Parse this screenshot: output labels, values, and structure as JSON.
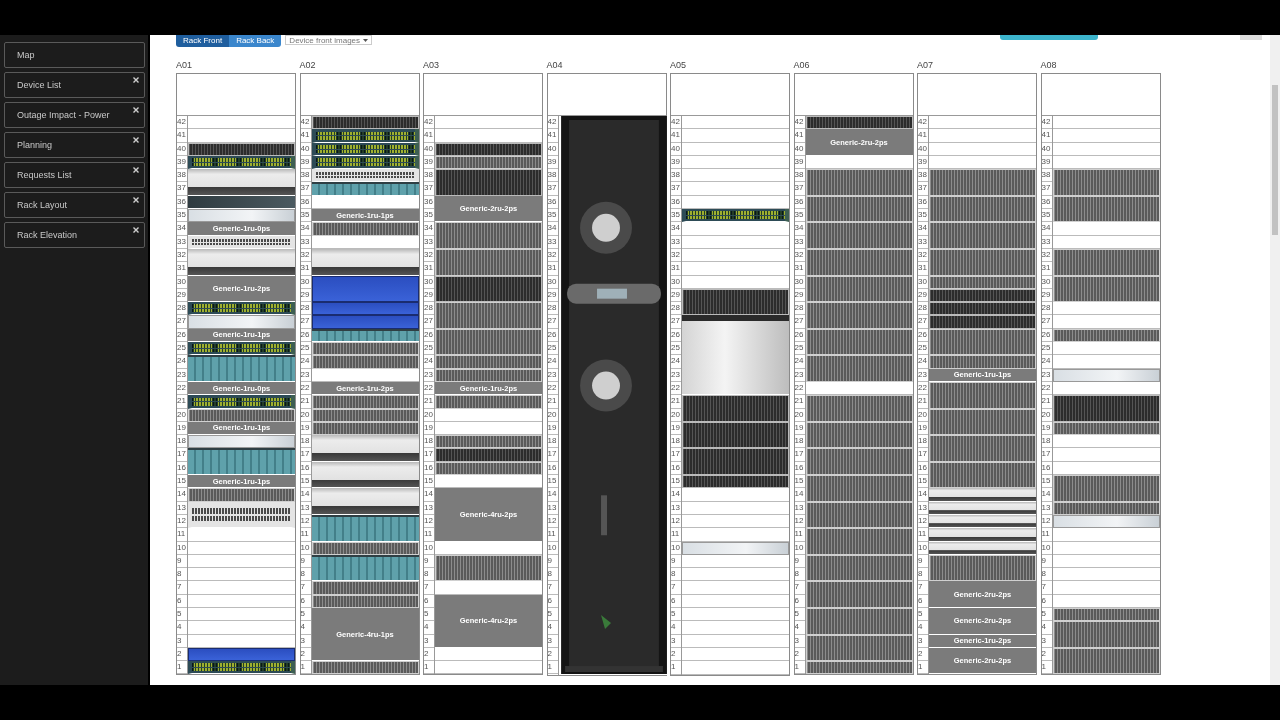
{
  "sidebar": {
    "items": [
      {
        "label": "Map",
        "closable": false
      },
      {
        "label": "Device List",
        "closable": true
      },
      {
        "label": "Outage Impact - Power",
        "closable": true
      },
      {
        "label": "Planning",
        "closable": true
      },
      {
        "label": "Requests List",
        "closable": true
      },
      {
        "label": "Rack Layout",
        "closable": true
      },
      {
        "label": "Rack Elevation",
        "closable": true
      }
    ]
  },
  "toolbar": {
    "tabs": [
      {
        "label": "Rack Front",
        "selected": true
      },
      {
        "label": "Rack Back",
        "selected": false
      }
    ],
    "dropdown": {
      "value": "Device front images"
    }
  },
  "racks": [
    {
      "name": "A01",
      "slots": [
        {
          "kind": "empty",
          "units": [
            "42",
            "41"
          ]
        },
        {
          "kind": "blade_dark",
          "units": [
            "40"
          ]
        },
        {
          "kind": "switch",
          "units": [
            "39"
          ]
        },
        {
          "kind": "server",
          "units": [
            "38",
            "37"
          ]
        },
        {
          "kind": "appliance_dark",
          "units": [
            "36"
          ]
        },
        {
          "kind": "appliance",
          "units": [
            "35"
          ]
        },
        {
          "kind": "generic",
          "units": [
            "34"
          ],
          "label": "Generic-1ru-0ps"
        },
        {
          "kind": "switch_light",
          "units": [
            "33"
          ]
        },
        {
          "kind": "server",
          "units": [
            "32",
            "31"
          ]
        },
        {
          "kind": "generic",
          "units": [
            "30",
            "29"
          ],
          "label": "Generic-1ru-2ps"
        },
        {
          "kind": "switch",
          "units": [
            "28"
          ]
        },
        {
          "kind": "appliance",
          "units": [
            "27"
          ]
        },
        {
          "kind": "generic",
          "units": [
            "26"
          ],
          "label": "Generic-1ru-1ps"
        },
        {
          "kind": "switch",
          "units": [
            "25"
          ]
        },
        {
          "kind": "chassis",
          "units": [
            "24",
            "23"
          ]
        },
        {
          "kind": "generic",
          "units": [
            "22"
          ],
          "label": "Generic-1ru-0ps"
        },
        {
          "kind": "switch",
          "units": [
            "21"
          ]
        },
        {
          "kind": "blade",
          "units": [
            "20"
          ]
        },
        {
          "kind": "generic",
          "units": [
            "19"
          ],
          "label": "Generic-1ru-1ps"
        },
        {
          "kind": "appliance",
          "units": [
            "18"
          ]
        },
        {
          "kind": "chassis",
          "units": [
            "17",
            "16"
          ]
        },
        {
          "kind": "generic",
          "units": [
            "15"
          ],
          "label": "Generic-1ru-1ps"
        },
        {
          "kind": "blade",
          "units": [
            "14"
          ]
        },
        {
          "kind": "switch_light",
          "units": [
            "13",
            "12"
          ]
        },
        {
          "kind": "empty",
          "units": [
            "11",
            "10",
            "9",
            "8",
            "7",
            "6",
            "5",
            "4",
            "3"
          ]
        },
        {
          "kind": "blue",
          "units": [
            "2"
          ]
        },
        {
          "kind": "switch",
          "units": [
            "1"
          ]
        }
      ]
    },
    {
      "name": "A02",
      "slots": [
        {
          "kind": "blade_dark",
          "units": [
            "42"
          ]
        },
        {
          "kind": "switch",
          "units": [
            "41"
          ]
        },
        {
          "kind": "switch",
          "units": [
            "40"
          ]
        },
        {
          "kind": "switch",
          "units": [
            "39"
          ]
        },
        {
          "kind": "switch_light",
          "units": [
            "38"
          ]
        },
        {
          "kind": "chassis",
          "units": [
            "37"
          ]
        },
        {
          "kind": "empty",
          "units": [
            "36"
          ]
        },
        {
          "kind": "generic",
          "units": [
            "35"
          ],
          "label": "Generic-1ru-1ps"
        },
        {
          "kind": "blade",
          "units": [
            "34"
          ]
        },
        {
          "kind": "empty",
          "units": [
            "33"
          ]
        },
        {
          "kind": "server",
          "units": [
            "32",
            "31"
          ]
        },
        {
          "kind": "blue",
          "units": [
            "30",
            "29"
          ]
        },
        {
          "kind": "blue",
          "units": [
            "28"
          ]
        },
        {
          "kind": "blue",
          "units": [
            "27"
          ]
        },
        {
          "kind": "chassis",
          "units": [
            "26"
          ]
        },
        {
          "kind": "blade",
          "units": [
            "25"
          ]
        },
        {
          "kind": "blade",
          "units": [
            "24"
          ]
        },
        {
          "kind": "empty",
          "units": [
            "23"
          ]
        },
        {
          "kind": "generic",
          "units": [
            "22"
          ],
          "label": "Generic-1ru-2ps"
        },
        {
          "kind": "blade",
          "units": [
            "21"
          ]
        },
        {
          "kind": "blade",
          "units": [
            "20"
          ]
        },
        {
          "kind": "blade",
          "units": [
            "19"
          ]
        },
        {
          "kind": "server",
          "units": [
            "18",
            "17"
          ]
        },
        {
          "kind": "server",
          "units": [
            "16",
            "15"
          ]
        },
        {
          "kind": "server",
          "units": [
            "14",
            "13"
          ]
        },
        {
          "kind": "chassis",
          "units": [
            "12",
            "11"
          ]
        },
        {
          "kind": "blade",
          "units": [
            "10"
          ]
        },
        {
          "kind": "chassis",
          "units": [
            "9",
            "8"
          ]
        },
        {
          "kind": "blade",
          "units": [
            "7"
          ]
        },
        {
          "kind": "blade",
          "units": [
            "6"
          ]
        },
        {
          "kind": "generic",
          "units": [
            "5",
            "4",
            "3",
            "2"
          ],
          "label": "Generic-4ru-1ps"
        },
        {
          "kind": "blade",
          "units": [
            "1"
          ]
        }
      ]
    },
    {
      "name": "A03",
      "slots": [
        {
          "kind": "empty",
          "units": [
            "42",
            "41"
          ]
        },
        {
          "kind": "blade_dark",
          "units": [
            "40"
          ]
        },
        {
          "kind": "blade",
          "units": [
            "39"
          ]
        },
        {
          "kind": "blade_dark",
          "units": [
            "38",
            "37"
          ]
        },
        {
          "kind": "generic",
          "units": [
            "36",
            "35"
          ],
          "label": "Generic-2ru-2ps"
        },
        {
          "kind": "blade",
          "units": [
            "34",
            "33"
          ]
        },
        {
          "kind": "blade",
          "units": [
            "32",
            "31"
          ]
        },
        {
          "kind": "blade_dark",
          "units": [
            "30",
            "29"
          ]
        },
        {
          "kind": "blade",
          "units": [
            "28",
            "27"
          ]
        },
        {
          "kind": "blade",
          "units": [
            "26",
            "25"
          ]
        },
        {
          "kind": "blade",
          "units": [
            "24"
          ]
        },
        {
          "kind": "blade",
          "units": [
            "23"
          ]
        },
        {
          "kind": "generic",
          "units": [
            "22"
          ],
          "label": "Generic-1ru-2ps"
        },
        {
          "kind": "blade",
          "units": [
            "21"
          ]
        },
        {
          "kind": "empty",
          "units": [
            "20",
            "19"
          ]
        },
        {
          "kind": "blade",
          "units": [
            "18"
          ]
        },
        {
          "kind": "blade_dark",
          "units": [
            "17"
          ]
        },
        {
          "kind": "blade",
          "units": [
            "16"
          ]
        },
        {
          "kind": "empty",
          "units": [
            "15"
          ]
        },
        {
          "kind": "generic",
          "units": [
            "14",
            "13",
            "12",
            "11"
          ],
          "label": "Generic-4ru-2ps"
        },
        {
          "kind": "empty",
          "units": [
            "10"
          ]
        },
        {
          "kind": "blade",
          "units": [
            "9",
            "8"
          ]
        },
        {
          "kind": "empty",
          "units": [
            "7"
          ]
        },
        {
          "kind": "generic",
          "units": [
            "6",
            "5",
            "4",
            "3"
          ],
          "label": "Generic-4ru-2ps"
        },
        {
          "kind": "empty",
          "units": [
            "2",
            "1"
          ]
        }
      ]
    },
    {
      "name": "A04",
      "slots": [
        {
          "kind": "cooler",
          "units": [
            "42",
            "41",
            "40",
            "39",
            "38",
            "37",
            "36",
            "35",
            "34",
            "33",
            "32",
            "31",
            "30",
            "29",
            "28",
            "27",
            "26",
            "25",
            "24",
            "23",
            "22",
            "21",
            "20",
            "19",
            "18",
            "17",
            "16",
            "15",
            "14",
            "13",
            "12",
            "11",
            "10",
            "9",
            "8",
            "7",
            "6",
            "5",
            "4",
            "3",
            "2",
            "1"
          ]
        }
      ]
    },
    {
      "name": "A05",
      "slots": [
        {
          "kind": "empty",
          "units": [
            "42",
            "41",
            "40",
            "39",
            "38",
            "37",
            "36"
          ]
        },
        {
          "kind": "switch",
          "units": [
            "35"
          ]
        },
        {
          "kind": "empty",
          "units": [
            "34",
            "33",
            "32",
            "31",
            "30"
          ]
        },
        {
          "kind": "blade_dark",
          "units": [
            "29",
            "28"
          ]
        },
        {
          "kind": "storage",
          "units": [
            "27",
            "26",
            "25",
            "24",
            "23",
            "22"
          ]
        },
        {
          "kind": "blade_dark",
          "units": [
            "21",
            "20"
          ]
        },
        {
          "kind": "blade_dark",
          "units": [
            "19",
            "18"
          ]
        },
        {
          "kind": "blade_dark",
          "units": [
            "17",
            "16"
          ]
        },
        {
          "kind": "blade_dark",
          "units": [
            "15"
          ]
        },
        {
          "kind": "empty",
          "units": [
            "14",
            "13",
            "12",
            "11"
          ]
        },
        {
          "kind": "appliance",
          "units": [
            "10"
          ]
        },
        {
          "kind": "empty",
          "units": [
            "9",
            "8",
            "7",
            "6",
            "5",
            "4",
            "3",
            "2",
            "1"
          ]
        }
      ]
    },
    {
      "name": "A06",
      "slots": [
        {
          "kind": "blade_dark",
          "units": [
            "42"
          ]
        },
        {
          "kind": "generic",
          "units": [
            "41",
            "40"
          ],
          "label": "Generic-2ru-2ps"
        },
        {
          "kind": "empty",
          "units": [
            "39"
          ]
        },
        {
          "kind": "blade",
          "units": [
            "38",
            "37"
          ]
        },
        {
          "kind": "blade",
          "units": [
            "36",
            "35"
          ]
        },
        {
          "kind": "blade",
          "units": [
            "34",
            "33"
          ]
        },
        {
          "kind": "blade",
          "units": [
            "32",
            "31"
          ]
        },
        {
          "kind": "blade",
          "units": [
            "30",
            "29"
          ]
        },
        {
          "kind": "blade",
          "units": [
            "28",
            "27"
          ]
        },
        {
          "kind": "blade",
          "units": [
            "26",
            "25"
          ]
        },
        {
          "kind": "blade",
          "units": [
            "24",
            "23"
          ]
        },
        {
          "kind": "empty",
          "units": [
            "22"
          ]
        },
        {
          "kind": "blade",
          "units": [
            "21",
            "20"
          ]
        },
        {
          "kind": "blade",
          "units": [
            "19",
            "18"
          ]
        },
        {
          "kind": "blade",
          "units": [
            "17",
            "16"
          ]
        },
        {
          "kind": "blade",
          "units": [
            "15",
            "14"
          ]
        },
        {
          "kind": "blade",
          "units": [
            "13",
            "12"
          ]
        },
        {
          "kind": "blade",
          "units": [
            "11",
            "10"
          ]
        },
        {
          "kind": "blade",
          "units": [
            "9",
            "8"
          ]
        },
        {
          "kind": "blade",
          "units": [
            "7",
            "6"
          ]
        },
        {
          "kind": "blade",
          "units": [
            "5",
            "4"
          ]
        },
        {
          "kind": "blade",
          "units": [
            "3",
            "2"
          ]
        },
        {
          "kind": "blade",
          "units": [
            "1"
          ]
        }
      ]
    },
    {
      "name": "A07",
      "slots": [
        {
          "kind": "empty",
          "units": [
            "42",
            "41",
            "40",
            "39"
          ]
        },
        {
          "kind": "blade",
          "units": [
            "38",
            "37"
          ]
        },
        {
          "kind": "blade",
          "units": [
            "36",
            "35"
          ]
        },
        {
          "kind": "blade",
          "units": [
            "34",
            "33"
          ]
        },
        {
          "kind": "blade",
          "units": [
            "32",
            "31"
          ]
        },
        {
          "kind": "blade",
          "units": [
            "30"
          ]
        },
        {
          "kind": "blade_dark",
          "units": [
            "29"
          ]
        },
        {
          "kind": "blade_dark",
          "units": [
            "28"
          ]
        },
        {
          "kind": "blade_dark",
          "units": [
            "27"
          ]
        },
        {
          "kind": "blade",
          "units": [
            "26",
            "25"
          ]
        },
        {
          "kind": "blade",
          "units": [
            "24"
          ]
        },
        {
          "kind": "generic",
          "units": [
            "23"
          ],
          "label": "Generic-1ru-1ps"
        },
        {
          "kind": "blade",
          "units": [
            "22",
            "21"
          ]
        },
        {
          "kind": "blade",
          "units": [
            "20",
            "19"
          ]
        },
        {
          "kind": "blade",
          "units": [
            "18",
            "17"
          ]
        },
        {
          "kind": "blade",
          "units": [
            "16",
            "15"
          ]
        },
        {
          "kind": "server",
          "units": [
            "14"
          ]
        },
        {
          "kind": "server",
          "units": [
            "13"
          ]
        },
        {
          "kind": "server",
          "units": [
            "12"
          ]
        },
        {
          "kind": "server",
          "units": [
            "11"
          ]
        },
        {
          "kind": "server",
          "units": [
            "10"
          ]
        },
        {
          "kind": "blade",
          "units": [
            "9",
            "8"
          ]
        },
        {
          "kind": "generic",
          "units": [
            "7",
            "6"
          ],
          "label": "Generic-2ru-2ps"
        },
        {
          "kind": "generic",
          "units": [
            "5",
            "4"
          ],
          "label": "Generic-2ru-2ps"
        },
        {
          "kind": "generic",
          "units": [
            "3"
          ],
          "label": "Generic-1ru-2ps"
        },
        {
          "kind": "generic",
          "units": [
            "2",
            "1"
          ],
          "label": "Generic-2ru-2ps"
        }
      ]
    },
    {
      "name": "A08",
      "slots": [
        {
          "kind": "empty",
          "units": [
            "42",
            "41",
            "40",
            "39"
          ]
        },
        {
          "kind": "blade",
          "units": [
            "38",
            "37"
          ]
        },
        {
          "kind": "blade",
          "units": [
            "36",
            "35"
          ]
        },
        {
          "kind": "empty",
          "units": [
            "34",
            "33"
          ]
        },
        {
          "kind": "blade",
          "units": [
            "32",
            "31"
          ]
        },
        {
          "kind": "blade",
          "units": [
            "30",
            "29"
          ]
        },
        {
          "kind": "empty",
          "units": [
            "28",
            "27"
          ]
        },
        {
          "kind": "blade",
          "units": [
            "26"
          ]
        },
        {
          "kind": "empty",
          "units": [
            "25",
            "24"
          ]
        },
        {
          "kind": "appliance",
          "units": [
            "23"
          ]
        },
        {
          "kind": "empty",
          "units": [
            "22"
          ]
        },
        {
          "kind": "blade_dark",
          "units": [
            "21",
            "20"
          ]
        },
        {
          "kind": "blade",
          "units": [
            "19"
          ]
        },
        {
          "kind": "empty",
          "units": [
            "18",
            "17",
            "16"
          ]
        },
        {
          "kind": "blade",
          "units": [
            "15",
            "14"
          ]
        },
        {
          "kind": "blade",
          "units": [
            "13"
          ]
        },
        {
          "kind": "appliance",
          "units": [
            "12"
          ]
        },
        {
          "kind": "empty",
          "units": [
            "11",
            "10",
            "9",
            "8",
            "7",
            "6"
          ]
        },
        {
          "kind": "blade",
          "units": [
            "5"
          ]
        },
        {
          "kind": "blade",
          "units": [
            "4",
            "3"
          ]
        },
        {
          "kind": "blade",
          "units": [
            "2",
            "1"
          ]
        }
      ]
    }
  ]
}
